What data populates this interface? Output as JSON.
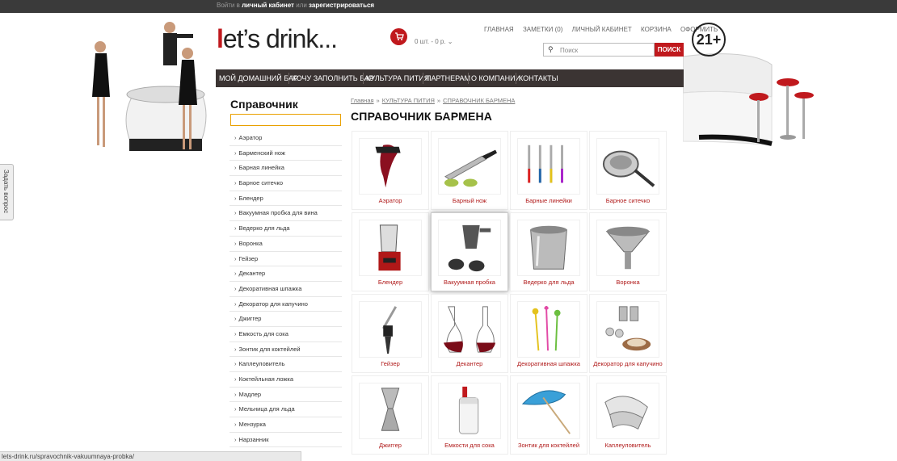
{
  "topbar": {
    "login_prefix": "Войти в",
    "login_link": "личный кабинет",
    "or": "или",
    "register_link": "зарегистрироваться"
  },
  "header": {
    "logo_text": "et’s drink...",
    "logo_letter": "l",
    "cart_summary": "0 шт. - 0 р.",
    "links": [
      "ГЛАВНАЯ",
      "ЗАМЕТКИ (0)",
      "ЛИЧНЫЙ КАБИНЕТ",
      "КОРЗИНА",
      "ОФОРМИТЬ"
    ],
    "age_badge": "21+",
    "search_placeholder": "Поиск",
    "search_button": "ПОИСК"
  },
  "nav": [
    "МОЙ ДОМАШНИЙ БАР",
    "ХОЧУ ЗАПОЛНИТЬ БАР",
    "КУЛЬТУРА ПИТИЯ",
    "ПАРТНЕРАМ",
    "О КОМПАНИИ",
    "КОНТАКТЫ"
  ],
  "sidebar": {
    "title": "Справочник",
    "items": [
      "Аэратор",
      "Барменский нож",
      "Барная линейка",
      "Барное ситечко",
      "Блендер",
      "Вакуумная пробка для вина",
      "Ведерко для льда",
      "Воронка",
      "Гейзер",
      "Декантер",
      "Декоративная шпажка",
      "Декоратор для капучино",
      "Джиггер",
      "Емкость для сока",
      "Зонтик для коктейлей",
      "Каплеуловитель",
      "Коктейльная ложка",
      "Мадлер",
      "Мельница для льда",
      "Мензурка",
      "Нарзанник"
    ]
  },
  "breadcrumb": [
    "Главная",
    "КУЛЬТУРА ПИТИЯ",
    "СПРАВОЧНИК БАРМЕНА"
  ],
  "main": {
    "title": "СПРАВОЧНИК БАРМЕНА",
    "products": [
      {
        "caption": "Аэратор"
      },
      {
        "caption": "Барный нож"
      },
      {
        "caption": "Барные линейки"
      },
      {
        "caption": "Барное ситечко"
      },
      {
        "caption": "Блендер"
      },
      {
        "caption": "Вакуумная пробка"
      },
      {
        "caption": "Ведерко для льда"
      },
      {
        "caption": "Воронка"
      },
      {
        "caption": "Гейзер"
      },
      {
        "caption": "Декантер"
      },
      {
        "caption": "Декоративная шпажка"
      },
      {
        "caption": "Декоратор для капучино"
      },
      {
        "caption": "Джиггер"
      },
      {
        "caption": "Емкости для сока"
      },
      {
        "caption": "Зонтик для коктейлей"
      },
      {
        "caption": "Каплеуловитель"
      }
    ]
  },
  "feedback_tab": "Задать вопрос",
  "status_url": "lets-drink.ru/spravochnik-vakuumnaya-probka/",
  "colors": {
    "accent": "#c0191d",
    "nav_bg": "#3b3433",
    "caption": "#b01a1a"
  }
}
